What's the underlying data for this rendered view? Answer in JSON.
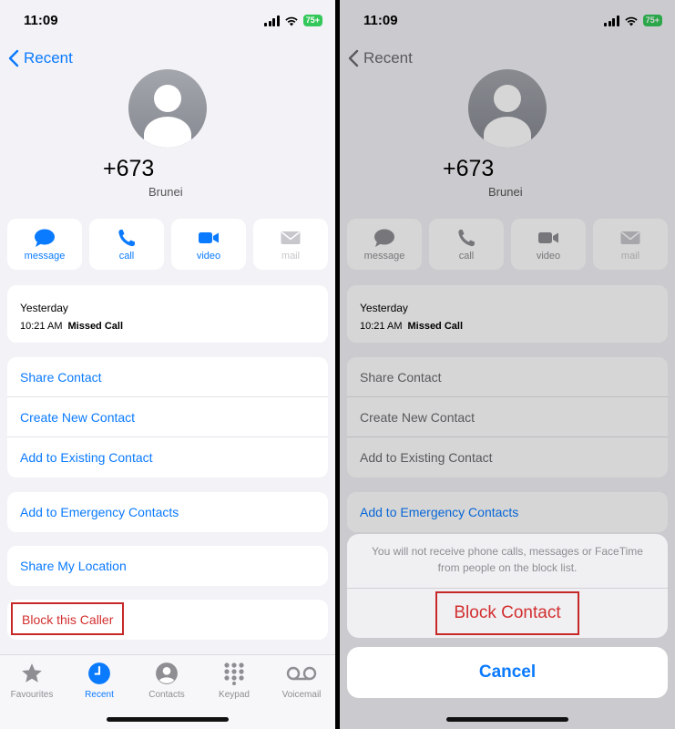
{
  "status": {
    "time": "11:09",
    "battery": "75+"
  },
  "nav": {
    "back_label": "Recent"
  },
  "contact": {
    "number": "+673",
    "country": "Brunei"
  },
  "actions": [
    {
      "label": "message",
      "icon": "message-bubble-icon",
      "enabled": true
    },
    {
      "label": "call",
      "icon": "phone-icon",
      "enabled": true
    },
    {
      "label": "video",
      "icon": "video-camera-icon",
      "enabled": true
    },
    {
      "label": "mail",
      "icon": "mail-envelope-icon",
      "enabled": false
    }
  ],
  "recent": {
    "day": "Yesterday",
    "time": "10:21 AM",
    "type": "Missed Call"
  },
  "contact_options": [
    "Share Contact",
    "Create New Contact",
    "Add to Existing Contact"
  ],
  "emergency_label": "Add to Emergency Contacts",
  "share_location_label": "Share My Location",
  "block_label": "Block this Caller",
  "tabs": [
    {
      "label": "Favourites",
      "icon": "star-icon",
      "active": false
    },
    {
      "label": "Recent",
      "icon": "clock-icon",
      "active": true
    },
    {
      "label": "Contacts",
      "icon": "person-circle-icon",
      "active": false
    },
    {
      "label": "Keypad",
      "icon": "keypad-icon",
      "active": false
    },
    {
      "label": "Voicemail",
      "icon": "voicemail-icon",
      "active": false
    }
  ],
  "sheet": {
    "message": "You will not receive phone calls, messages or FaceTime from people on the block list.",
    "confirm_label": "Block Contact",
    "cancel_label": "Cancel"
  },
  "colors": {
    "accent": "#0a7aff",
    "destructive": "#d32f2f",
    "highlight_box": "#c62828",
    "background": "#f2f2f7"
  }
}
